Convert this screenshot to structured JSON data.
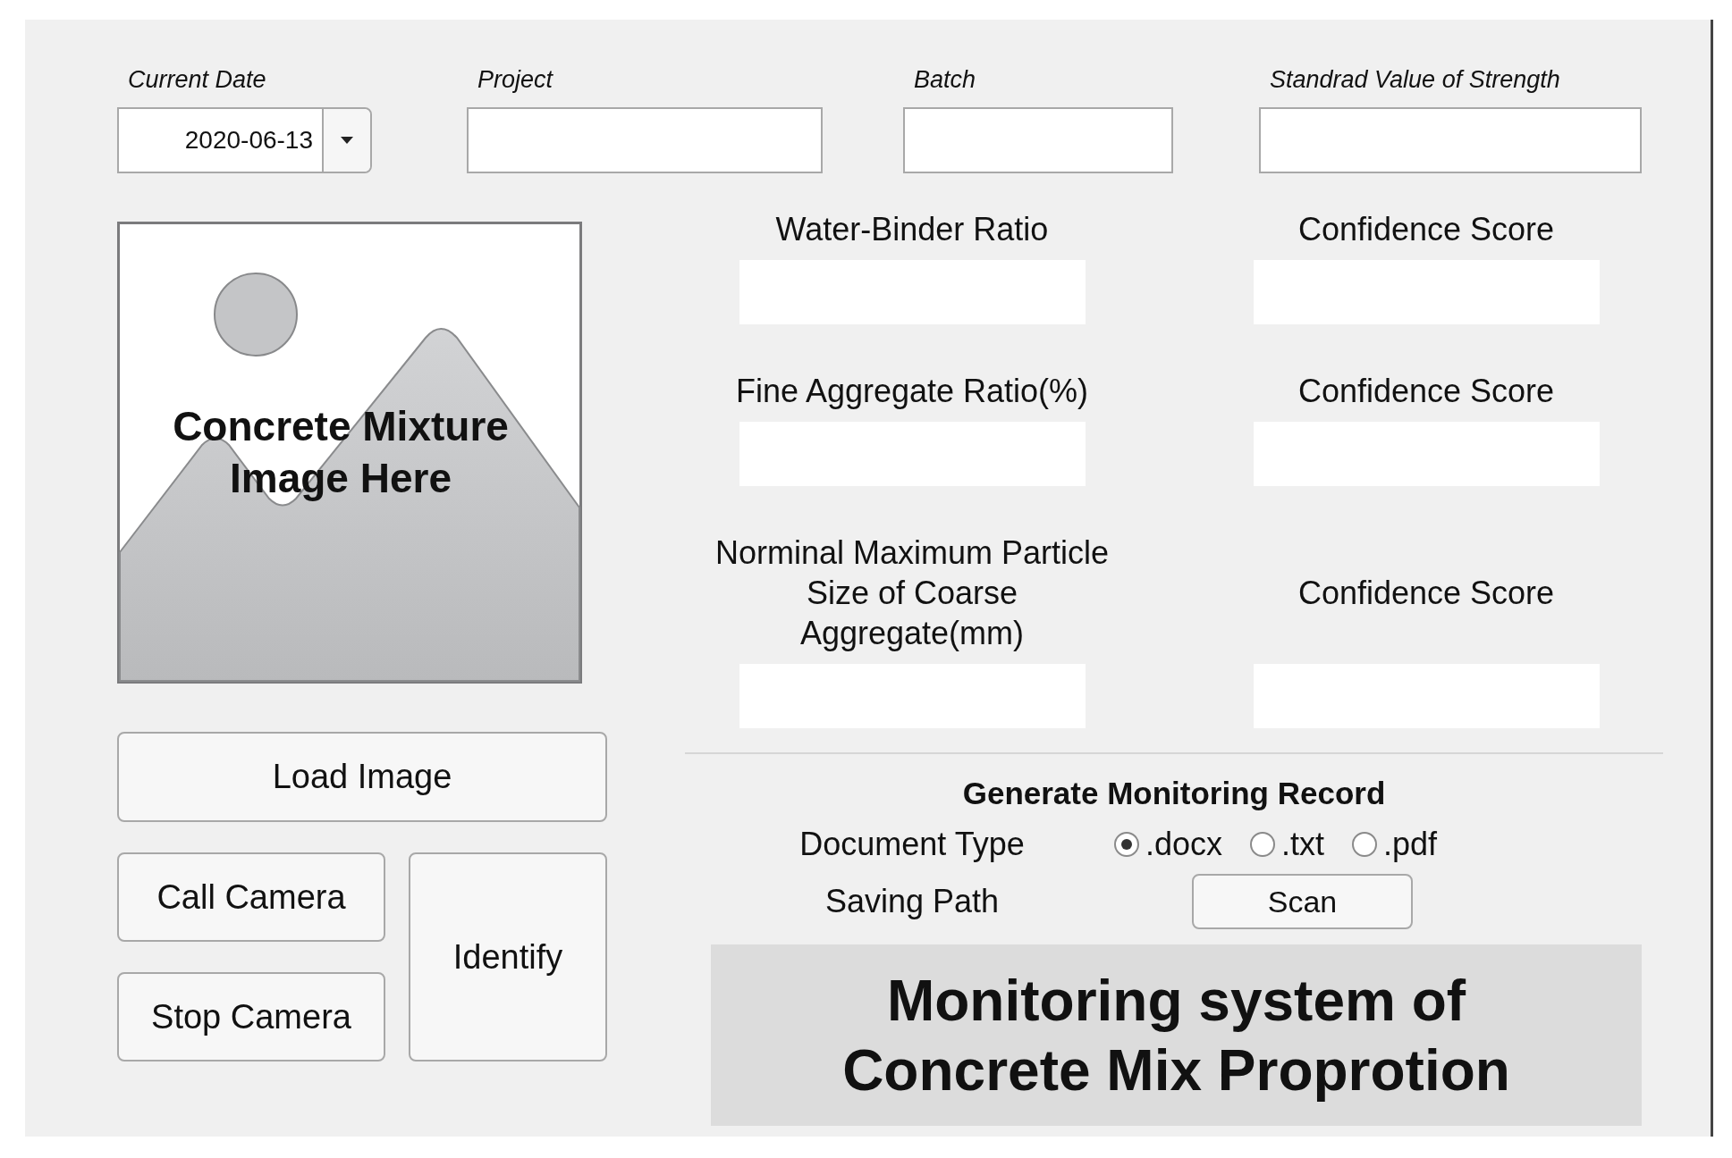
{
  "date_picker": {
    "label": "Current Date",
    "value": "2020-06-13"
  },
  "fields": [
    {
      "label": "Project"
    },
    {
      "label": "Batch"
    },
    {
      "label": "Standrad Value of Strength"
    }
  ],
  "image_panel": {
    "text": "Concrete Mixture Image Here"
  },
  "buttons": [
    {
      "kind": "load",
      "label": "Load Image"
    },
    {
      "kind": "call",
      "label": "Call Camera"
    },
    {
      "kind": "identify",
      "label": "Identify"
    },
    {
      "kind": "stop",
      "label": "Stop Camera"
    }
  ],
  "outputs": [
    {
      "label": "Water-Binder Ratio",
      "confidence_label": "Confidence Score"
    },
    {
      "label": "Fine Aggregate Ratio(%)",
      "confidence_label": "Confidence Score"
    },
    {
      "label": "Norminal Maximum Particle Size of Coarse Aggregate(mm)",
      "confidence_label": "Confidence Score"
    }
  ],
  "record": {
    "title": "Generate Monitoring Record",
    "document_type_label": "Document Type",
    "options": [
      {
        "label": ".docx",
        "selected": true
      },
      {
        "label": ".txt",
        "selected": false
      },
      {
        "label": ".pdf",
        "selected": false
      }
    ],
    "saving_path_label": "Saving Path",
    "scan_button": "Scan"
  },
  "banner": {
    "lines": [
      "Monitoring system of",
      "Concrete Mix Proprotion"
    ]
  }
}
